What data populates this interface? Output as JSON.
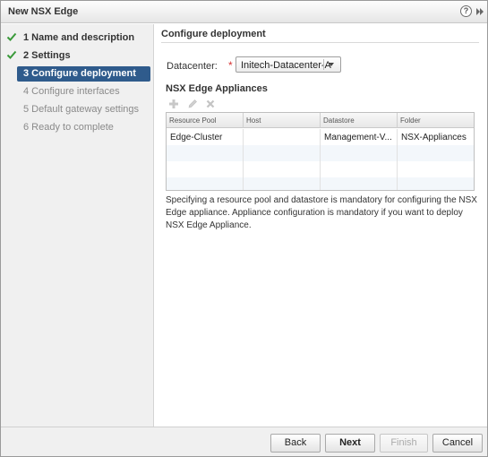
{
  "window": {
    "title": "New NSX Edge",
    "help_glyph": "?",
    "icons": {
      "help": "help-icon",
      "expand": "double-chevron-right-icon"
    }
  },
  "steps": [
    {
      "number": "1",
      "label": "Name and description",
      "text": "1  Name and description",
      "state": "done"
    },
    {
      "number": "2",
      "label": "Settings",
      "text": "2  Settings",
      "state": "done"
    },
    {
      "number": "3",
      "label": "Configure deployment",
      "text": "3 Configure deployment",
      "state": "active"
    },
    {
      "number": "4",
      "label": "Configure interfaces",
      "text": "4 Configure interfaces",
      "state": "disabled"
    },
    {
      "number": "5",
      "label": "Default gateway settings",
      "text": "5 Default gateway settings",
      "state": "disabled"
    },
    {
      "number": "6",
      "label": "Ready to complete",
      "text": "6 Ready to complete",
      "state": "disabled"
    }
  ],
  "main": {
    "section_title": "Configure deployment",
    "datacenter": {
      "label": "Datacenter:",
      "required_marker": "*",
      "selected": "Initech-Datacenter-A"
    },
    "appliances": {
      "title": "NSX Edge Appliances",
      "toolbar": {
        "add": "plus-icon",
        "edit": "pencil-icon",
        "delete": "x-icon"
      },
      "columns": [
        "Resource Pool",
        "Host",
        "Datastore",
        "Folder"
      ],
      "rows": [
        [
          "Edge-Cluster",
          "",
          "Management-V...",
          "NSX-Appliances"
        ]
      ]
    },
    "note": "Specifying a resource pool and datastore is mandatory for configuring the NSX Edge appliance. Appliance configuration is mandatory if you want to deploy NSX Edge Appliance."
  },
  "footer": {
    "back": "Back",
    "next": "Next",
    "finish": "Finish",
    "cancel": "Cancel"
  },
  "colors": {
    "active_step_bg": "#2f5b8c",
    "check_green": "#3a9a3a",
    "required_red": "#d63333",
    "nav_bg": "#f0f0f0"
  }
}
